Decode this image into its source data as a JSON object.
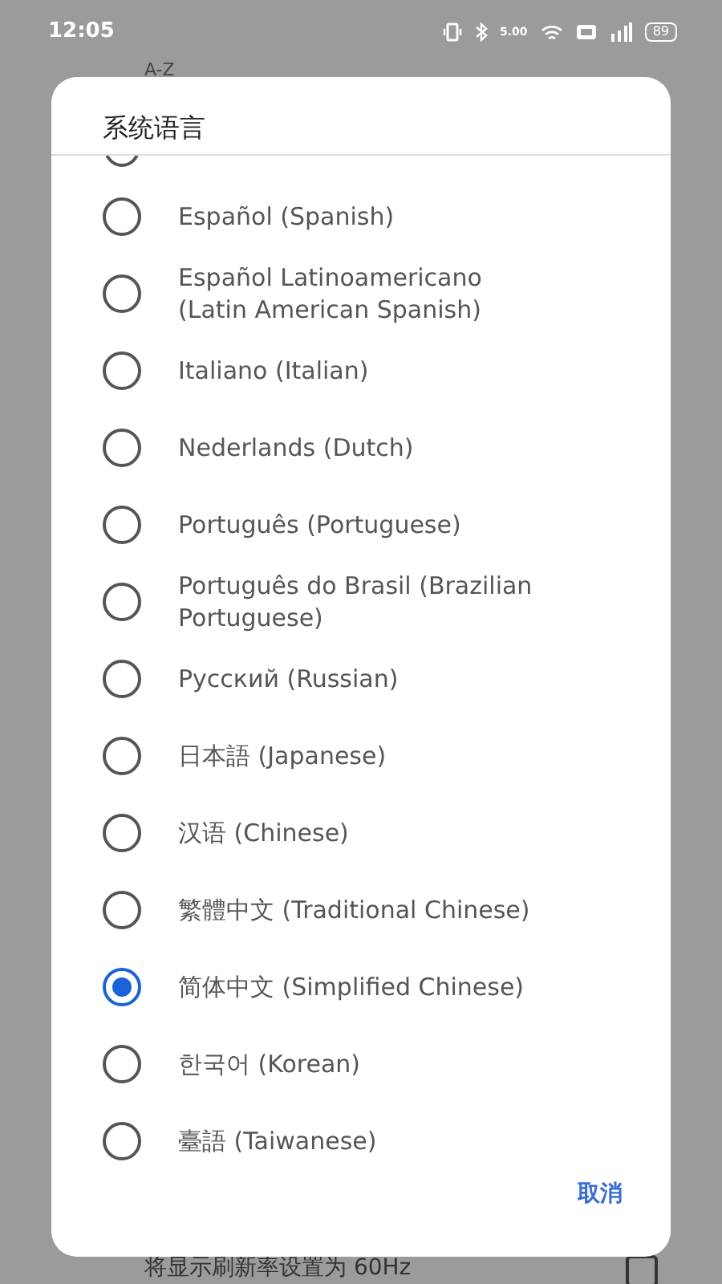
{
  "status_bar": {
    "time": "12:05",
    "speed": "5.00",
    "battery": "89"
  },
  "background": {
    "sort_label": "A-Z",
    "setting_text": "将显示刷新率设置为 60Hz",
    "checkbox_checked": false
  },
  "dialog": {
    "title": "系统语言",
    "cut_off_option": {
      "selected": false
    },
    "options": [
      {
        "label": "Español (Spanish)",
        "selected": false
      },
      {
        "label": "Español Latinoamericano (Latin American Spanish)",
        "selected": false
      },
      {
        "label": "Italiano (Italian)",
        "selected": false
      },
      {
        "label": "Nederlands (Dutch)",
        "selected": false
      },
      {
        "label": "Português (Portuguese)",
        "selected": false
      },
      {
        "label": "Português do Brasil (Brazilian Portuguese)",
        "selected": false
      },
      {
        "label": "Русский (Russian)",
        "selected": false
      },
      {
        "label": "日本語 (Japanese)",
        "selected": false
      },
      {
        "label": "汉语 (Chinese)",
        "selected": false
      },
      {
        "label": "繁體中文 (Traditional Chinese)",
        "selected": false
      },
      {
        "label": "简体中文 (Simplified Chinese)",
        "selected": true
      },
      {
        "label": "한국어 (Korean)",
        "selected": false
      },
      {
        "label": "臺語 (Taiwanese)",
        "selected": false
      }
    ],
    "cancel_button": "取消"
  }
}
